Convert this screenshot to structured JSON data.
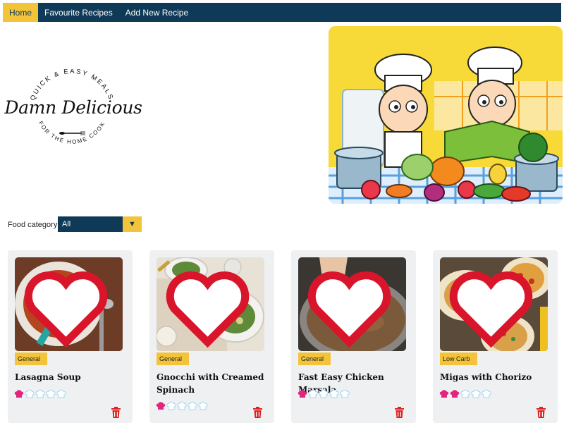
{
  "nav": {
    "items": [
      {
        "label": "Home",
        "active": true
      },
      {
        "label": "Favourite Recipes",
        "active": false
      },
      {
        "label": "Add New Recipe",
        "active": false
      }
    ]
  },
  "logo": {
    "brand": "Damn Delicious",
    "top_text": "QUICK & EASY MEALS",
    "bottom_text": "FOR THE HOME COOK"
  },
  "filter": {
    "label": "Food category",
    "selected": "All",
    "arrow_icon": "triangle-down-icon"
  },
  "cards": [
    {
      "category": "General",
      "title": "Lasagna Soup",
      "rating": 1,
      "max_rating": 5,
      "image": "lasagna-soup-photo"
    },
    {
      "category": "General",
      "title": "Gnocchi with Creamed Spinach",
      "rating": 1,
      "max_rating": 5,
      "image": "gnocchi-photo"
    },
    {
      "category": "General",
      "title": "Fast Easy Chicken Marsala",
      "rating": 1,
      "max_rating": 5,
      "image": "chicken-marsala-photo"
    },
    {
      "category": "Low Carb",
      "title": "Migas with Chorizo",
      "rating": 2,
      "max_rating": 5,
      "image": "migas-photo"
    }
  ],
  "colors": {
    "nav_bg": "#0e3a57",
    "accent": "#f3c43a",
    "card_bg": "#eff0f2",
    "rating_filled": "#e0267e",
    "rating_empty": "#9fd7ee",
    "delete_red": "#e02020",
    "heart_red": "#d9152c"
  }
}
